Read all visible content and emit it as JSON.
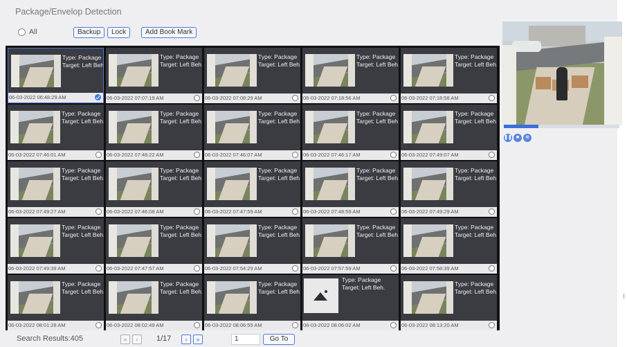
{
  "header": {
    "title": "Package/Envelop Detection"
  },
  "toolbar": {
    "all_label": "All",
    "backup_label": "Backup",
    "lock_label": "Lock",
    "bookmark_label": "Add Book Mark"
  },
  "items": [
    {
      "type": "Type: Package",
      "target": "Target: Left Beh.",
      "time": "06-03-2022 06:48:29 AM",
      "checked": true,
      "selected": true
    },
    {
      "type": "Type: Package",
      "target": "Target: Left Beh.",
      "time": "06-03-2022 07:07:19 AM"
    },
    {
      "type": "Type: Package",
      "target": "Target: Left Beh.",
      "time": "06-03-2022 07:08:29 AM"
    },
    {
      "type": "Type: Package",
      "target": "Target: Left Beh.",
      "time": "06-03-2022 07:18:56 AM"
    },
    {
      "type": "Type: Package",
      "target": "Target: Left Beh.",
      "time": "06-03-2022 07:18:58 AM"
    },
    {
      "type": "Type: Package",
      "target": "Target: Left Beh.",
      "time": "06-03-2022 07:46:01 AM"
    },
    {
      "type": "Type: Package",
      "target": "Target: Left Beh.",
      "time": "06-03-2022 07:48:22 AM"
    },
    {
      "type": "Type: Package",
      "target": "Target: Left Beh.",
      "time": "06-03-2022 07:46:07 AM"
    },
    {
      "type": "Type: Package",
      "target": "Target: Left Beh.",
      "time": "06-03-2022 07:46:17 AM"
    },
    {
      "type": "Type: Package",
      "target": "Target: Left Beh.",
      "time": "06-03-2022 07:49:07 AM"
    },
    {
      "type": "Type: Package",
      "target": "Target: Left Beh.",
      "time": "06-03-2022 07:49:27 AM"
    },
    {
      "type": "Type: Package",
      "target": "Target: Left Beh.",
      "time": "06-03-2022 07:46:08 AM"
    },
    {
      "type": "Type: Package",
      "target": "Target: Left Beh.",
      "time": "06-03-2022 07:47:59 AM"
    },
    {
      "type": "Type: Package",
      "target": "Target: Left Beh.",
      "time": "06-03-2022 07:48:59 AM"
    },
    {
      "type": "Type: Package",
      "target": "Target: Left Beh.",
      "time": "06-03-2022 07:49:29 AM"
    },
    {
      "type": "Type: Package",
      "target": "Target: Left Beh.",
      "time": "06-03-2022 07:49:39 AM"
    },
    {
      "type": "Type: Package",
      "target": "Target: Left Beh.",
      "time": "06-03-2022 07:47:57 AM"
    },
    {
      "type": "Type: Package",
      "target": "Target: Left Beh.",
      "time": "06-03-2022 07:54:29 AM"
    },
    {
      "type": "Type: Package",
      "target": "Target: Left Beh.",
      "time": "06-03-2022 07:57:59 AM"
    },
    {
      "type": "Type: Package",
      "target": "Target: Left Beh.",
      "time": "06-03-2022 07:58:39 AM"
    },
    {
      "type": "Type: Package",
      "target": "Target: Left Beh.",
      "time": "06-03-2022 08:01:28 AM"
    },
    {
      "type": "Type: Package",
      "target": "Target: Left Beh.",
      "time": "06-03-2022 08:02:49 AM"
    },
    {
      "type": "Type: Package",
      "target": "Target: Left Beh.",
      "time": "06-03-2022 08:06:59 AM"
    },
    {
      "type": "Type: Package",
      "target": "Target: Left Beh.",
      "time": "06-03-2022 08:06:02 AM",
      "placeholder": true
    },
    {
      "type": "Type: Package",
      "target": "Target: Left Beh.",
      "time": "06-03-2022 08:13:20 AM"
    }
  ],
  "player": {
    "progress": 0.3
  },
  "footer": {
    "results": "Search Results:405",
    "page": "1/17",
    "goto_value": "1",
    "goto_label": "Go To"
  },
  "colors": {
    "accent": "#3b6fd9",
    "grid_bg": "#111111",
    "cell_bg": "#3b3c42"
  }
}
